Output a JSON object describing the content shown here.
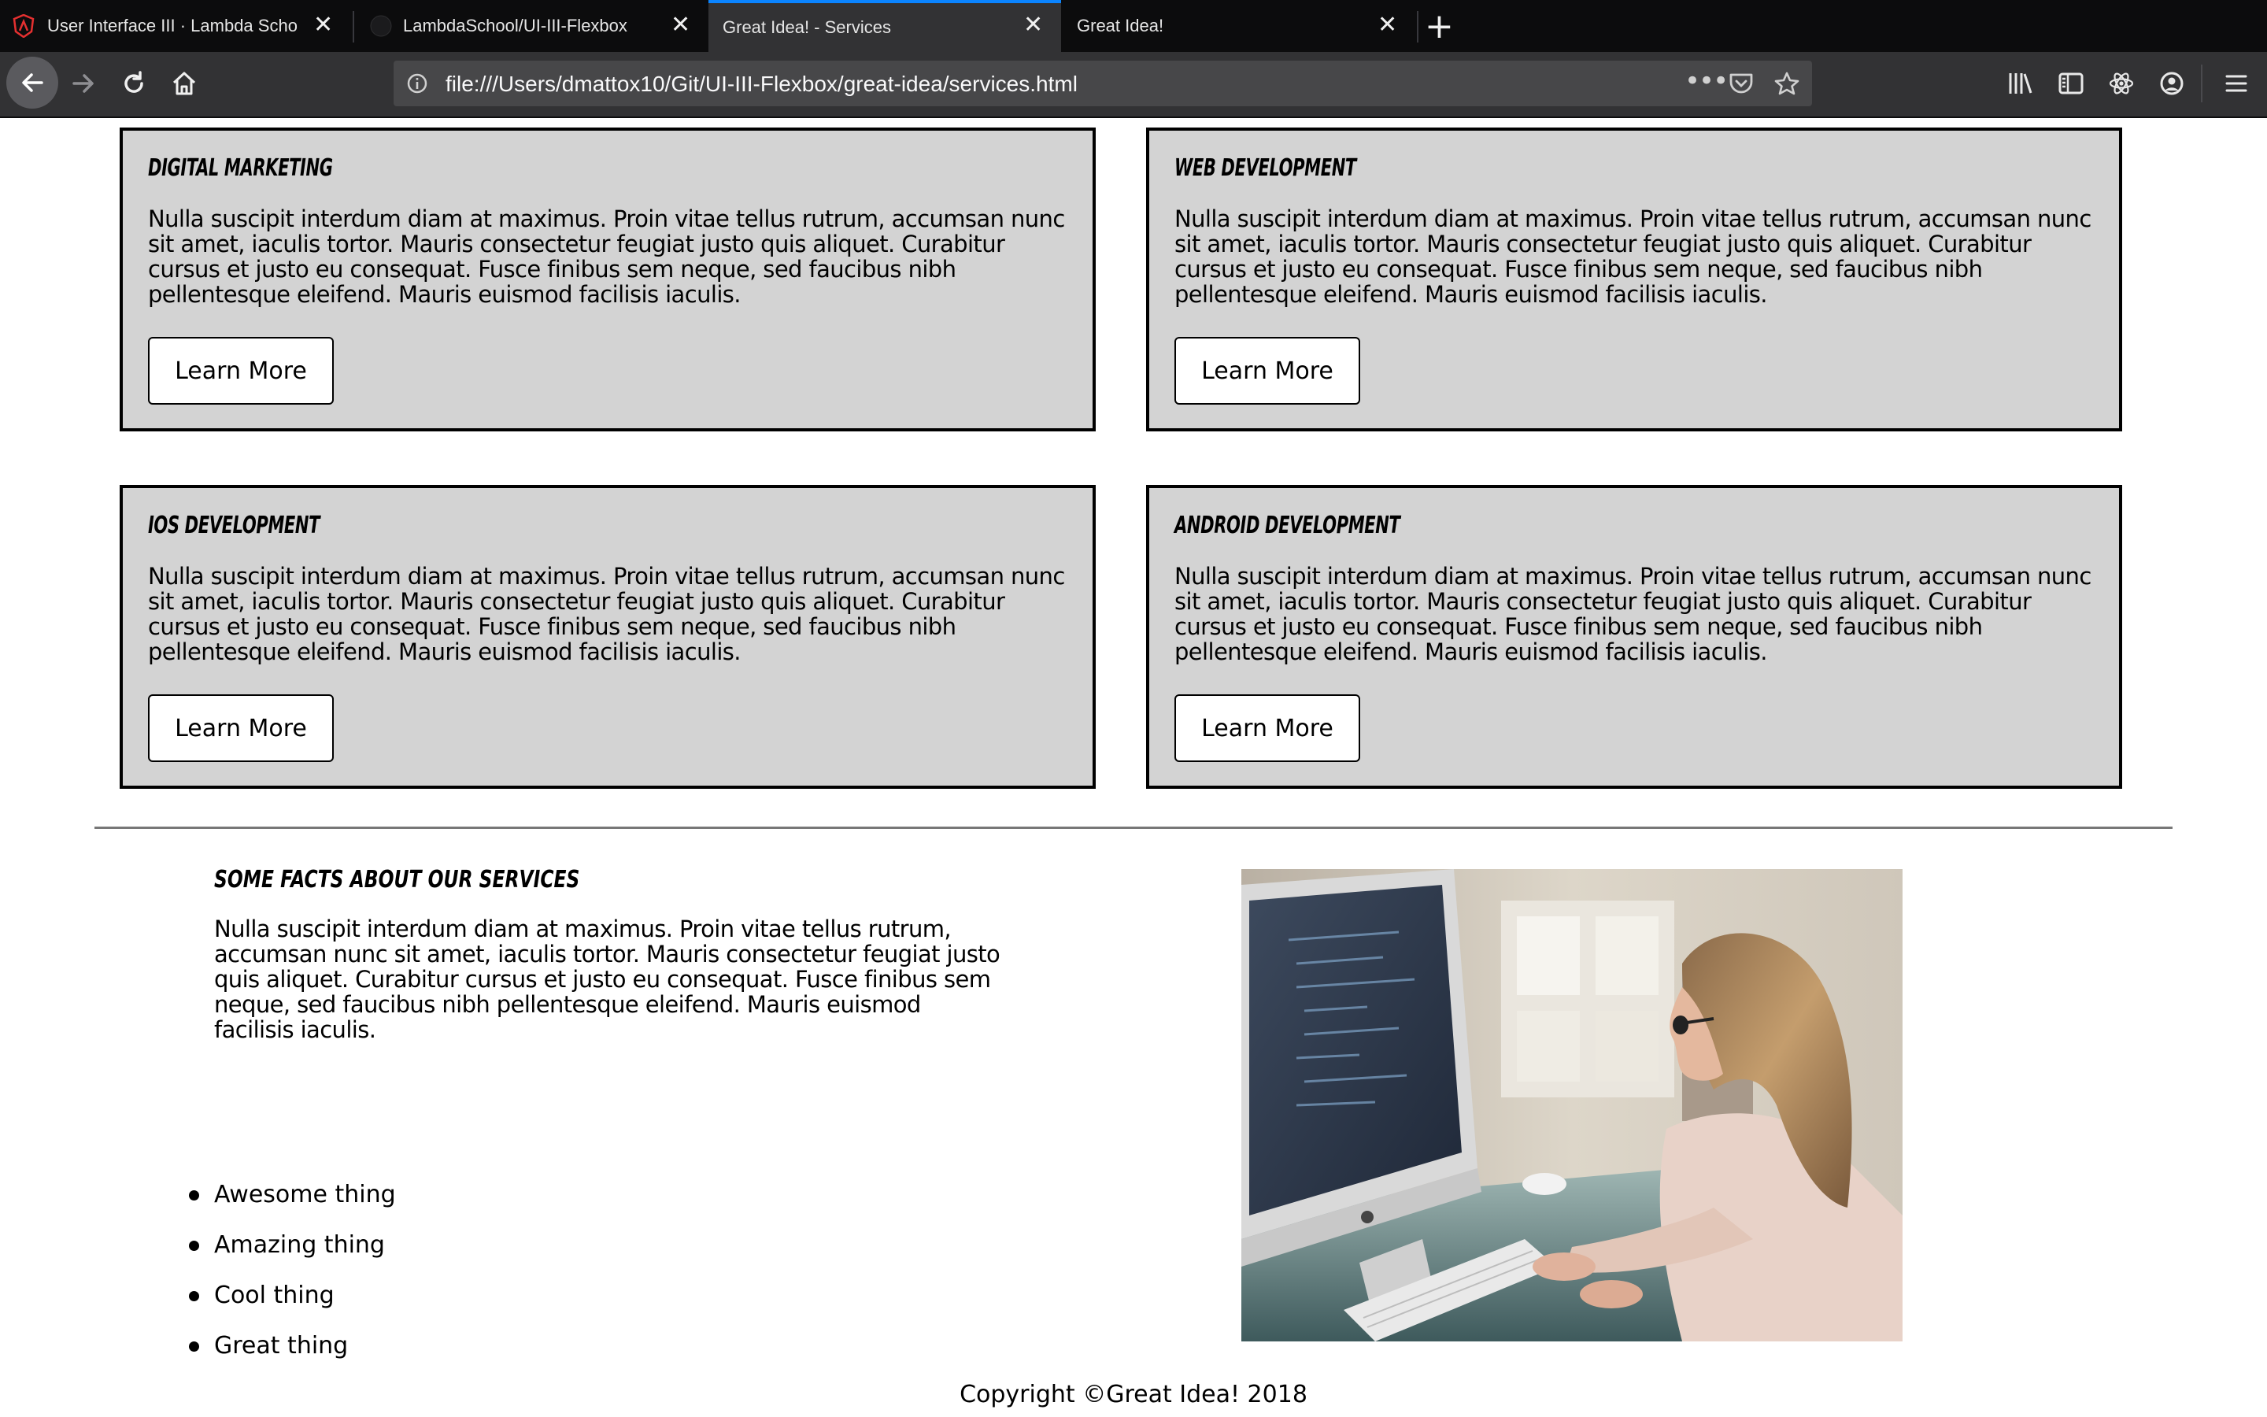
{
  "browser": {
    "tabs": [
      {
        "title": "User Interface III · Lambda Scho",
        "active": false
      },
      {
        "title": "LambdaSchool/UI-III-Flexbox",
        "active": false
      },
      {
        "title": "Great Idea! - Services",
        "active": true
      },
      {
        "title": "Great Idea!",
        "active": false
      }
    ],
    "url": "file:///Users/dmattox10/Git/UI-III-Flexbox/great-idea/services.html",
    "accent_color": "#0a84ff"
  },
  "services": [
    {
      "title": "DIGITAL MARKETING",
      "text": "Nulla suscipit interdum diam at maximus. Proin vitae tellus rutrum, accumsan nunc sit amet, iaculis tortor. Mauris consectetur feugiat justo quis aliquet. Curabitur cursus et justo eu consequat. Fusce finibus sem neque, sed faucibus nibh pellentesque eleifend. Mauris euismod facilisis iaculis.",
      "button": "Learn More"
    },
    {
      "title": "WEB DEVELOPMENT",
      "text": "Nulla suscipit interdum diam at maximus. Proin vitae tellus rutrum, accumsan nunc sit amet, iaculis tortor. Mauris consectetur feugiat justo quis aliquet. Curabitur cursus et justo eu consequat. Fusce finibus sem neque, sed faucibus nibh pellentesque eleifend. Mauris euismod facilisis iaculis.",
      "button": "Learn More"
    },
    {
      "title": "IOS DEVELOPMENT",
      "text": "Nulla suscipit interdum diam at maximus. Proin vitae tellus rutrum, accumsan nunc sit amet, iaculis tortor. Mauris consectetur feugiat justo quis aliquet. Curabitur cursus et justo eu consequat. Fusce finibus sem neque, sed faucibus nibh pellentesque eleifend. Mauris euismod facilisis iaculis.",
      "button": "Learn More"
    },
    {
      "title": "ANDROID DEVELOPMENT",
      "text": "Nulla suscipit interdum diam at maximus. Proin vitae tellus rutrum, accumsan nunc sit amet, iaculis tortor. Mauris consectetur feugiat justo quis aliquet. Curabitur cursus et justo eu consequat. Fusce finibus sem neque, sed faucibus nibh pellentesque eleifend. Mauris euismod facilisis iaculis.",
      "button": "Learn More"
    }
  ],
  "facts": {
    "title": "SOME FACTS ABOUT OUR SERVICES",
    "text": "Nulla suscipit interdum diam at maximus. Proin vitae tellus rutrum, accumsan nunc sit amet, iaculis tortor. Mauris consectetur feugiat justo quis aliquet. Curabitur cursus et justo eu consequat. Fusce finibus sem neque, sed faucibus nibh pellentesque eleifend. Mauris euismod facilisis iaculis.",
    "items": [
      "Awesome thing",
      "Amazing thing",
      "Cool thing",
      "Great thing"
    ]
  },
  "footer": {
    "copyright": "Copyright ©Great Idea! 2018"
  }
}
